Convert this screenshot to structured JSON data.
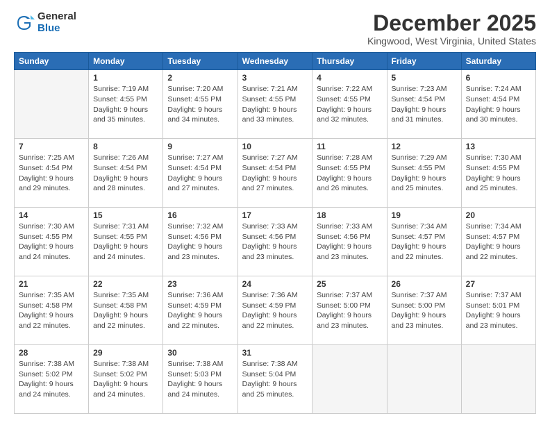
{
  "logo": {
    "general": "General",
    "blue": "Blue"
  },
  "header": {
    "month": "December 2025",
    "location": "Kingwood, West Virginia, United States"
  },
  "days_of_week": [
    "Sunday",
    "Monday",
    "Tuesday",
    "Wednesday",
    "Thursday",
    "Friday",
    "Saturday"
  ],
  "weeks": [
    [
      {
        "day": "",
        "empty": true
      },
      {
        "day": "1",
        "sunrise": "7:19 AM",
        "sunset": "4:55 PM",
        "daylight": "9 hours and 35 minutes."
      },
      {
        "day": "2",
        "sunrise": "7:20 AM",
        "sunset": "4:55 PM",
        "daylight": "9 hours and 34 minutes."
      },
      {
        "day": "3",
        "sunrise": "7:21 AM",
        "sunset": "4:55 PM",
        "daylight": "9 hours and 33 minutes."
      },
      {
        "day": "4",
        "sunrise": "7:22 AM",
        "sunset": "4:55 PM",
        "daylight": "9 hours and 32 minutes."
      },
      {
        "day": "5",
        "sunrise": "7:23 AM",
        "sunset": "4:54 PM",
        "daylight": "9 hours and 31 minutes."
      },
      {
        "day": "6",
        "sunrise": "7:24 AM",
        "sunset": "4:54 PM",
        "daylight": "9 hours and 30 minutes."
      }
    ],
    [
      {
        "day": "7",
        "sunrise": "7:25 AM",
        "sunset": "4:54 PM",
        "daylight": "9 hours and 29 minutes."
      },
      {
        "day": "8",
        "sunrise": "7:26 AM",
        "sunset": "4:54 PM",
        "daylight": "9 hours and 28 minutes."
      },
      {
        "day": "9",
        "sunrise": "7:27 AM",
        "sunset": "4:54 PM",
        "daylight": "9 hours and 27 minutes."
      },
      {
        "day": "10",
        "sunrise": "7:27 AM",
        "sunset": "4:54 PM",
        "daylight": "9 hours and 27 minutes."
      },
      {
        "day": "11",
        "sunrise": "7:28 AM",
        "sunset": "4:55 PM",
        "daylight": "9 hours and 26 minutes."
      },
      {
        "day": "12",
        "sunrise": "7:29 AM",
        "sunset": "4:55 PM",
        "daylight": "9 hours and 25 minutes."
      },
      {
        "day": "13",
        "sunrise": "7:30 AM",
        "sunset": "4:55 PM",
        "daylight": "9 hours and 25 minutes."
      }
    ],
    [
      {
        "day": "14",
        "sunrise": "7:30 AM",
        "sunset": "4:55 PM",
        "daylight": "9 hours and 24 minutes."
      },
      {
        "day": "15",
        "sunrise": "7:31 AM",
        "sunset": "4:55 PM",
        "daylight": "9 hours and 24 minutes."
      },
      {
        "day": "16",
        "sunrise": "7:32 AM",
        "sunset": "4:56 PM",
        "daylight": "9 hours and 23 minutes."
      },
      {
        "day": "17",
        "sunrise": "7:33 AM",
        "sunset": "4:56 PM",
        "daylight": "9 hours and 23 minutes."
      },
      {
        "day": "18",
        "sunrise": "7:33 AM",
        "sunset": "4:56 PM",
        "daylight": "9 hours and 23 minutes."
      },
      {
        "day": "19",
        "sunrise": "7:34 AM",
        "sunset": "4:57 PM",
        "daylight": "9 hours and 22 minutes."
      },
      {
        "day": "20",
        "sunrise": "7:34 AM",
        "sunset": "4:57 PM",
        "daylight": "9 hours and 22 minutes."
      }
    ],
    [
      {
        "day": "21",
        "sunrise": "7:35 AM",
        "sunset": "4:58 PM",
        "daylight": "9 hours and 22 minutes."
      },
      {
        "day": "22",
        "sunrise": "7:35 AM",
        "sunset": "4:58 PM",
        "daylight": "9 hours and 22 minutes."
      },
      {
        "day": "23",
        "sunrise": "7:36 AM",
        "sunset": "4:59 PM",
        "daylight": "9 hours and 22 minutes."
      },
      {
        "day": "24",
        "sunrise": "7:36 AM",
        "sunset": "4:59 PM",
        "daylight": "9 hours and 22 minutes."
      },
      {
        "day": "25",
        "sunrise": "7:37 AM",
        "sunset": "5:00 PM",
        "daylight": "9 hours and 23 minutes."
      },
      {
        "day": "26",
        "sunrise": "7:37 AM",
        "sunset": "5:00 PM",
        "daylight": "9 hours and 23 minutes."
      },
      {
        "day": "27",
        "sunrise": "7:37 AM",
        "sunset": "5:01 PM",
        "daylight": "9 hours and 23 minutes."
      }
    ],
    [
      {
        "day": "28",
        "sunrise": "7:38 AM",
        "sunset": "5:02 PM",
        "daylight": "9 hours and 24 minutes."
      },
      {
        "day": "29",
        "sunrise": "7:38 AM",
        "sunset": "5:02 PM",
        "daylight": "9 hours and 24 minutes."
      },
      {
        "day": "30",
        "sunrise": "7:38 AM",
        "sunset": "5:03 PM",
        "daylight": "9 hours and 24 minutes."
      },
      {
        "day": "31",
        "sunrise": "7:38 AM",
        "sunset": "5:04 PM",
        "daylight": "9 hours and 25 minutes."
      },
      {
        "day": "",
        "empty": true
      },
      {
        "day": "",
        "empty": true
      },
      {
        "day": "",
        "empty": true
      }
    ]
  ],
  "labels": {
    "sunrise": "Sunrise:",
    "sunset": "Sunset:",
    "daylight": "Daylight:"
  }
}
